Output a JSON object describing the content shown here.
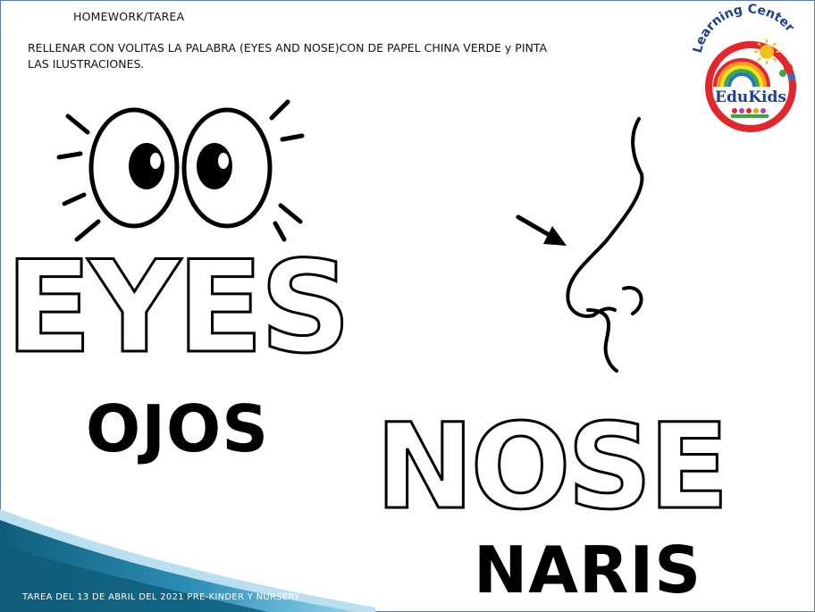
{
  "header": {
    "title": "HOMEWORK/TAREA",
    "instructions": "RELLENAR CON VOLITAS LA PALABRA (EYES AND NOSE)CON DE PAPEL CHINA VERDE y PINTA LAS ILUSTRACIONES."
  },
  "logo": {
    "arc_text": "Learning Center",
    "brand": "EduKids",
    "icon": "edukids-logo-icon"
  },
  "words": {
    "eyes": "EYES",
    "ojos": "OJOS",
    "nose": "NOSE",
    "naris": "NARIS"
  },
  "illustrations": {
    "eyes_icon": "eyes-icon",
    "nose_icon": "nose-icon",
    "arrow_icon": "arrow-icon"
  },
  "footer": {
    "text": "TAREA DEL 13 DE ABRIL DEL 2021 PRE-KINDER  Y NURSERY"
  },
  "colors": {
    "logo_red": "#e3262b",
    "logo_blue": "#1c3f94",
    "wave_dark": "#0f5d7a",
    "wave_light": "#5fb6d8",
    "sun": "#f4c01e"
  }
}
